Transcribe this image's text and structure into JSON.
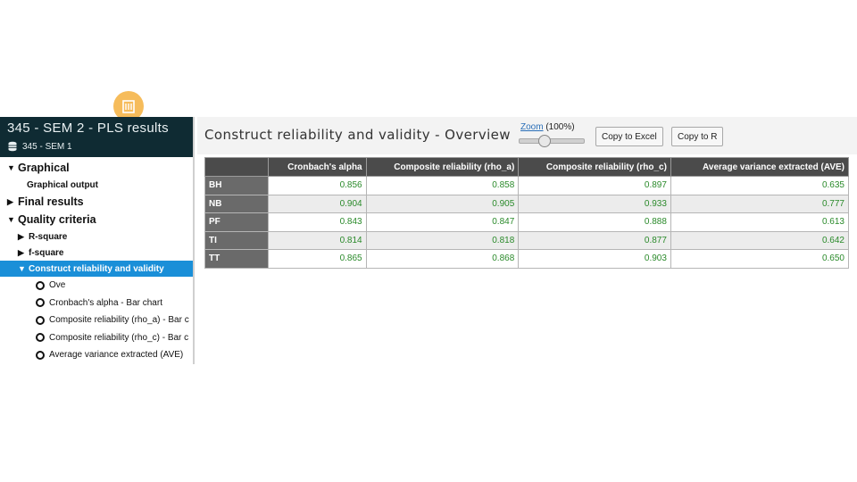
{
  "left_panel": {
    "title": "345 - SEM 2 - PLS results",
    "subtitle": "345 - SEM 1",
    "tree": {
      "graphical": "Graphical",
      "graphical_output": "Graphical output",
      "final_results": "Final results",
      "quality_criteria": "Quality criteria",
      "r_square": "R-square",
      "f_square": "f-square",
      "construct_reliability": "Construct reliability and validity",
      "radio_items": [
        "Ove",
        "Cronbach's alpha - Bar chart",
        "Composite reliability (rho_a) - Bar c",
        "Composite reliability (rho_c) - Bar c",
        "Average variance extracted (AVE)"
      ]
    }
  },
  "main": {
    "title": "Construct reliability and validity - Overview",
    "zoom_label": "Zoom",
    "zoom_value": "(100%)",
    "zoom_level": 100,
    "copy_excel": "Copy to Excel",
    "copy_r": "Copy to R"
  },
  "table": {
    "columns": [
      "",
      "Cronbach's alpha",
      "Composite reliability (rho_a)",
      "Composite reliability (rho_c)",
      "Average variance extracted (AVE)"
    ],
    "rows": [
      {
        "name": "BH",
        "values": [
          "0.856",
          "0.858",
          "0.897",
          "0.635"
        ]
      },
      {
        "name": "NB",
        "values": [
          "0.904",
          "0.905",
          "0.933",
          "0.777"
        ]
      },
      {
        "name": "PF",
        "values": [
          "0.843",
          "0.847",
          "0.888",
          "0.613"
        ]
      },
      {
        "name": "TI",
        "values": [
          "0.814",
          "0.818",
          "0.877",
          "0.642"
        ]
      },
      {
        "name": "TT",
        "values": [
          "0.865",
          "0.868",
          "0.903",
          "0.650"
        ]
      }
    ]
  },
  "colors": {
    "header_dark": "#0f2b33",
    "selected": "#1a8fd8",
    "value_green": "#2a8a2a",
    "table_header": "#4b4b4b"
  },
  "icons": {
    "logo": "building-icon",
    "database": "database-icon",
    "expanded": "caret-down-icon",
    "collapsed": "caret-right-icon"
  }
}
